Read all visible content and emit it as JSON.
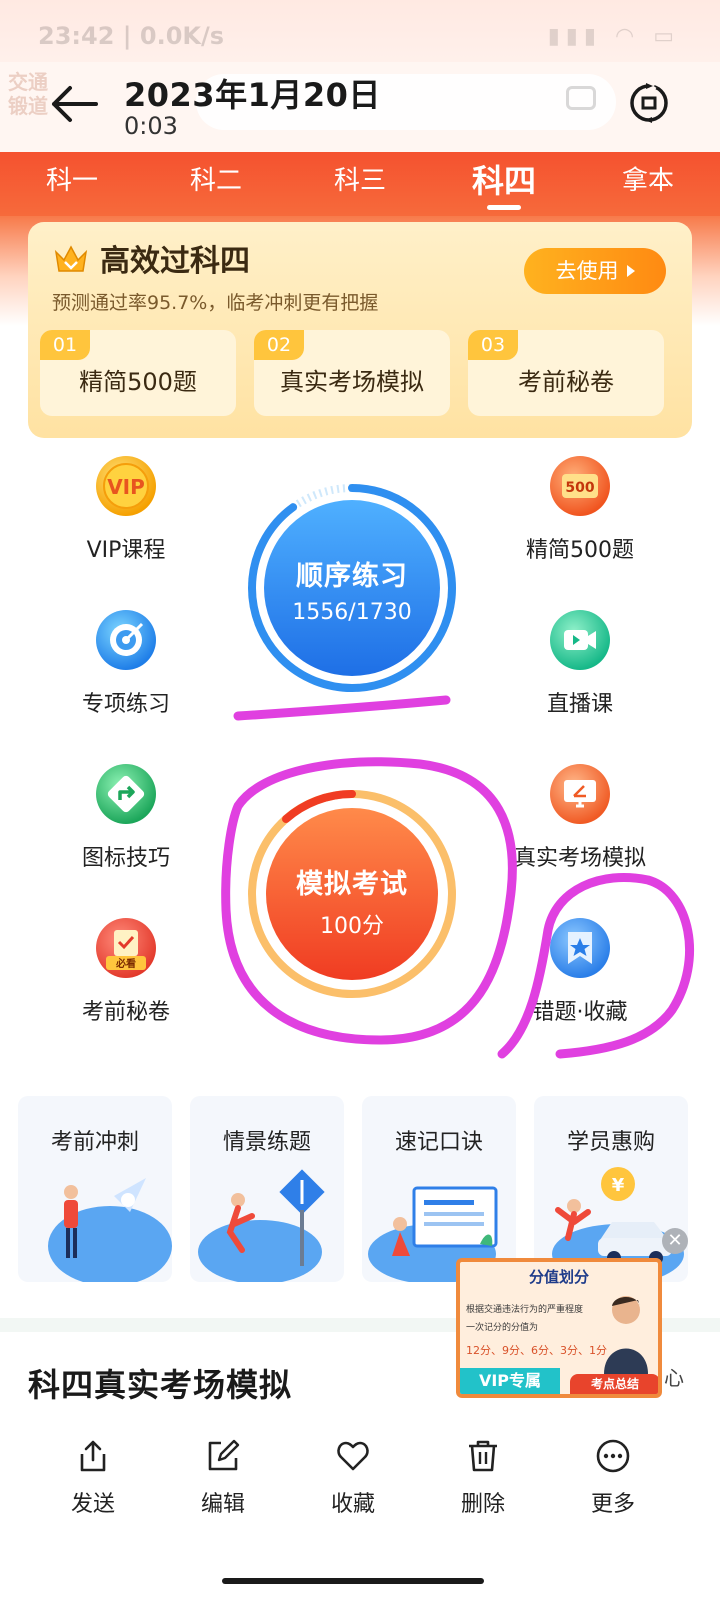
{
  "status_bar": {
    "text": "23:42 | 0.0K/s",
    "icons": "▮▮▮ ◠ ▭"
  },
  "viewer": {
    "title": "2023年1月20日",
    "time": "0:03",
    "ghost_logo": "交通\n锻道"
  },
  "tabs": [
    {
      "label": "科一",
      "active": false
    },
    {
      "label": "科二",
      "active": false
    },
    {
      "label": "科三",
      "active": false
    },
    {
      "label": "科四",
      "active": true
    },
    {
      "label": "拿本",
      "active": false
    }
  ],
  "vip_card": {
    "title": "高效过科四",
    "subtitle": "预测通过率95.7%，临考冲刺更有把握",
    "button": "去使用",
    "items": [
      {
        "no": "01",
        "label": "精简500题"
      },
      {
        "no": "02",
        "label": "真实考场模拟"
      },
      {
        "no": "03",
        "label": "考前秘卷"
      }
    ]
  },
  "features_left": [
    {
      "label": "VIP课程",
      "icon": "vip-icon"
    },
    {
      "label": "专项练习",
      "icon": "target-icon"
    },
    {
      "label": "图标技巧",
      "icon": "road-sign-icon"
    },
    {
      "label": "考前秘卷",
      "icon": "must-read-icon",
      "badge": "必看"
    }
  ],
  "features_right": [
    {
      "label": "精简500题",
      "icon": "500-icon",
      "badge": "500"
    },
    {
      "label": "直播课",
      "icon": "video-play-icon"
    },
    {
      "label": "真实考场模拟",
      "icon": "monitor-icon"
    },
    {
      "label": "错题·收藏",
      "icon": "star-bookmark-icon"
    }
  ],
  "sequential_practice": {
    "title": "顺序练习",
    "progress_text": "1556/1730",
    "done": 1556,
    "total": 1730,
    "color": "#2f8ff0"
  },
  "mock_exam": {
    "title": "模拟考试",
    "score_text": "100分",
    "color": "#f5522f"
  },
  "cards": [
    {
      "title": "考前冲刺"
    },
    {
      "title": "情景练题"
    },
    {
      "title": "速记口诀"
    },
    {
      "title": "学员惠购"
    }
  ],
  "section_title": "科四真实考场模拟",
  "video": {
    "title": "分值划分",
    "line1": "根据交通违法行为的严重程度",
    "line2": "一次记分的分值为",
    "scores": "12分、9分、6分、3分、1分",
    "vip": "VIP专属",
    "summary": "考点总结",
    "close": "✕",
    "side_char": "心"
  },
  "actions": [
    {
      "label": "发送",
      "icon": "share-icon"
    },
    {
      "label": "编辑",
      "icon": "edit-icon"
    },
    {
      "label": "收藏",
      "icon": "heart-icon"
    },
    {
      "label": "删除",
      "icon": "trash-icon"
    },
    {
      "label": "更多",
      "icon": "more-icon"
    }
  ],
  "colors": {
    "tab_bar": "#f5522f",
    "vip_card": "#ffe6a8",
    "annotation": "#e040e0",
    "progress_blue": "#2f8ff0",
    "exam_orange": "#f5522f"
  }
}
